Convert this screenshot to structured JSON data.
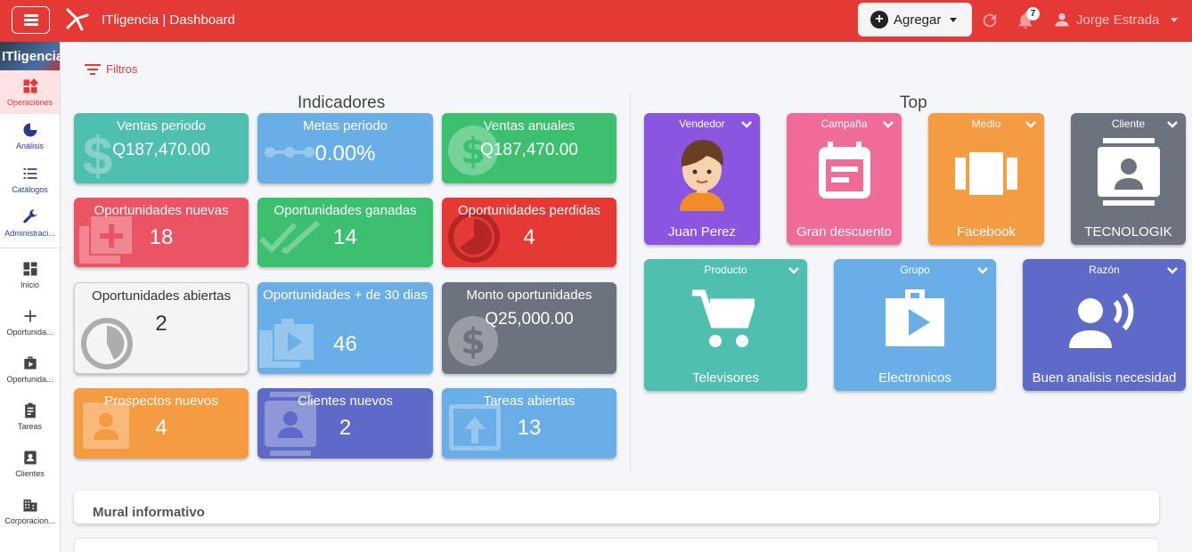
{
  "header": {
    "title": "ITligencia | Dashboard",
    "add_label": "Agregar",
    "notification_count": "7",
    "user_name": "Jorge Estrada"
  },
  "sidebar": {
    "brand": "ITligencia",
    "items": [
      {
        "label": "Operaciones",
        "icon": "dashboard-icon"
      },
      {
        "label": "Análisis",
        "icon": "pie-chart-icon"
      },
      {
        "label": "Catálogos",
        "icon": "list-icon"
      },
      {
        "label": "Administraci...",
        "icon": "wrench-icon"
      },
      {
        "label": "Inicio",
        "icon": "grid-icon"
      },
      {
        "label": "Oportunida...",
        "icon": "plus-icon"
      },
      {
        "label": "Oportunida...",
        "icon": "briefcase-icon"
      },
      {
        "label": "Tareas",
        "icon": "clipboard-icon"
      },
      {
        "label": "Clientes",
        "icon": "contact-icon"
      },
      {
        "label": "Corporacion...",
        "icon": "building-icon"
      }
    ]
  },
  "filters_label": "Filtros",
  "indicators": {
    "title": "Indicadores",
    "cards": [
      {
        "title": "Ventas periodo",
        "value": "Q187,470.00",
        "color": "#4fbfb0"
      },
      {
        "title": "Metas periodo",
        "value": "0.00%",
        "color": "#6aaee8"
      },
      {
        "title": "Ventas anuales",
        "value": "Q187,470.00",
        "color": "#3cbf6e"
      },
      {
        "title": "Oportunidades nuevas",
        "value": "18",
        "color": "#ea5463"
      },
      {
        "title": "Oportunidades ganadas",
        "value": "14",
        "color": "#3cbf6e"
      },
      {
        "title": "Oportunidades perdidas",
        "value": "4",
        "color": "#e53935"
      },
      {
        "title": "Oportunidades abiertas",
        "value": "2",
        "color": "#f4f4f4"
      },
      {
        "title": "Oportunidades + de 30 dias",
        "value": "46",
        "color": "#6aaee8"
      },
      {
        "title": "Monto oportunidades",
        "value": "Q25,000.00",
        "color": "#6c737e"
      },
      {
        "title": "Prospectos nuevos",
        "value": "4",
        "color": "#f59b42"
      },
      {
        "title": "Clientes nuevos",
        "value": "2",
        "color": "#5e6ac8"
      },
      {
        "title": "Tareas abiertas",
        "value": "13",
        "color": "#6aaee8"
      }
    ]
  },
  "top": {
    "title": "Top",
    "cards": [
      {
        "header": "Vendedor",
        "label": "Juan Perez",
        "color": "#8a55e0"
      },
      {
        "header": "Campaña",
        "label": "Gran descuento",
        "color": "#f06b98"
      },
      {
        "header": "Medio",
        "label": "Facebook",
        "color": "#f59b42"
      },
      {
        "header": "Cliente",
        "label": "TECNOLOGIK",
        "color": "#6c737e"
      },
      {
        "header": "Producto",
        "label": "Televisores",
        "color": "#4fbfb0"
      },
      {
        "header": "Grupo",
        "label": "Electronicos",
        "color": "#6aaee8"
      },
      {
        "header": "Razón",
        "label": "Buen analisis necesidad",
        "color": "#5e6ac8"
      }
    ]
  },
  "mural_title": "Mural informativo"
}
